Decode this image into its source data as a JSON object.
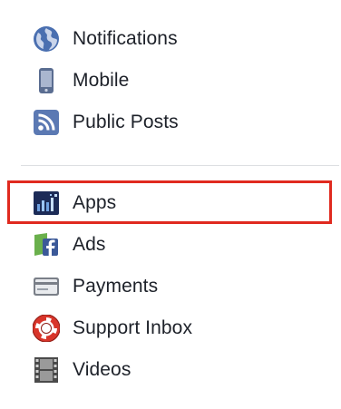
{
  "settings_menu": {
    "group1": [
      {
        "label": "Notifications",
        "icon": "globe-icon"
      },
      {
        "label": "Mobile",
        "icon": "mobile-phone-icon"
      },
      {
        "label": "Public Posts",
        "icon": "rss-icon"
      }
    ],
    "group2": [
      {
        "label": "Apps",
        "icon": "apps-icon",
        "highlighted": true
      },
      {
        "label": "Ads",
        "icon": "facebook-ads-icon"
      },
      {
        "label": "Payments",
        "icon": "credit-card-icon"
      },
      {
        "label": "Support Inbox",
        "icon": "lifebuoy-icon"
      },
      {
        "label": "Videos",
        "icon": "film-icon"
      }
    ]
  },
  "colors": {
    "highlight_border": "#e02a1f",
    "icon_blue": "#4b6ea9",
    "text": "#1d2129"
  }
}
